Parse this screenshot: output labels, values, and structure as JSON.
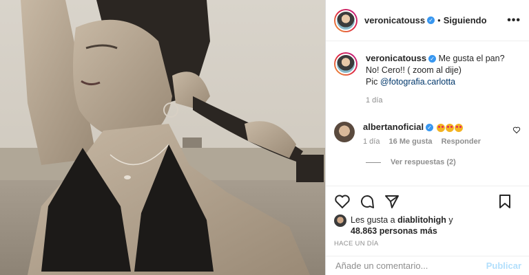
{
  "post": {
    "username": "veronicatouss",
    "follow_status": "Siguiendo",
    "more_icon": "more-horizontal-icon",
    "caption": {
      "username": "veronicatouss",
      "line1": "Me gusta el pan?",
      "line2": "No! Cero!! ( zoom al dije)",
      "line3_prefix": "Pic ",
      "mention": "@fotografia.carlotta",
      "time": "1 día"
    },
    "comments": [
      {
        "username": "albertanoficial",
        "time": "1 día",
        "likes": "16 Me gusta",
        "reply_label": "Responder",
        "view_replies": "Ver respuestas (2)"
      }
    ],
    "likes": {
      "prefix": "Les gusta a ",
      "user": "diablitohigh",
      "conj": " y",
      "count": "48.863 personas más"
    },
    "time_ago": "HACE UN DÍA",
    "comment_placeholder": "Añade un comentario...",
    "publish_label": "Publicar",
    "colors": {
      "accent": "#3897f0",
      "publish_disabled": "#b2dffc",
      "muted": "#8e8e8e"
    }
  }
}
